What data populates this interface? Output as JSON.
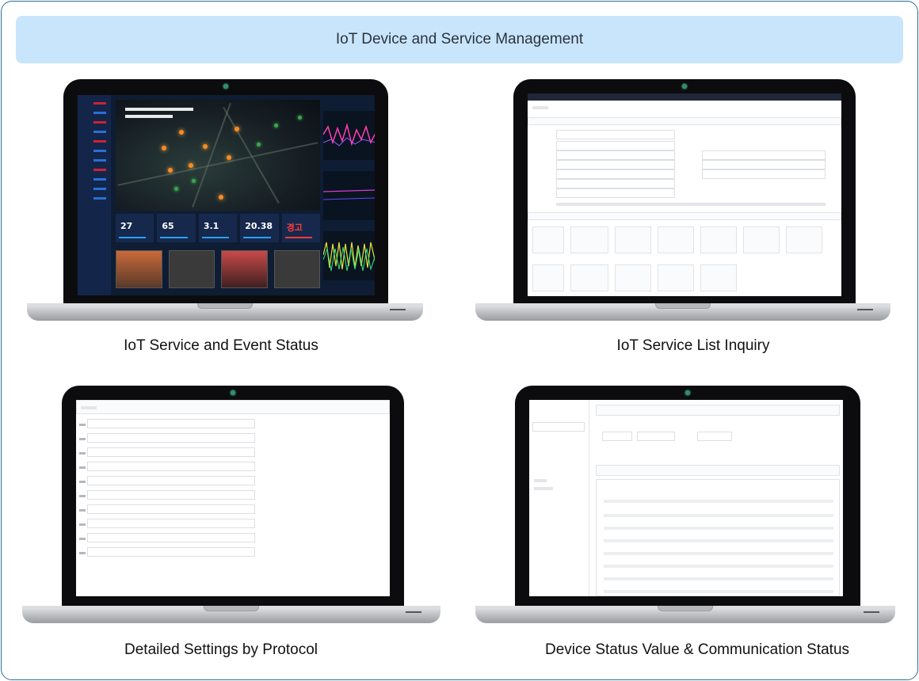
{
  "header": {
    "title": "IoT Device and Service Management"
  },
  "panels": [
    {
      "caption": "IoT Service and Event Status",
      "screen": "dashboard",
      "kpis": [
        "27",
        "65",
        "3.1",
        "20.38",
        "경고"
      ]
    },
    {
      "caption": "IoT Service List Inquiry",
      "screen": "service-list"
    },
    {
      "caption": "Detailed Settings by Protocol",
      "screen": "protocol-settings"
    },
    {
      "caption": "Device Status Value & Communication Status",
      "screen": "device-status"
    }
  ],
  "colors": {
    "title_bg": "#c9e5fb",
    "frame_border": "#2f6f8f",
    "dashboard_bg": "#0e1d33"
  }
}
